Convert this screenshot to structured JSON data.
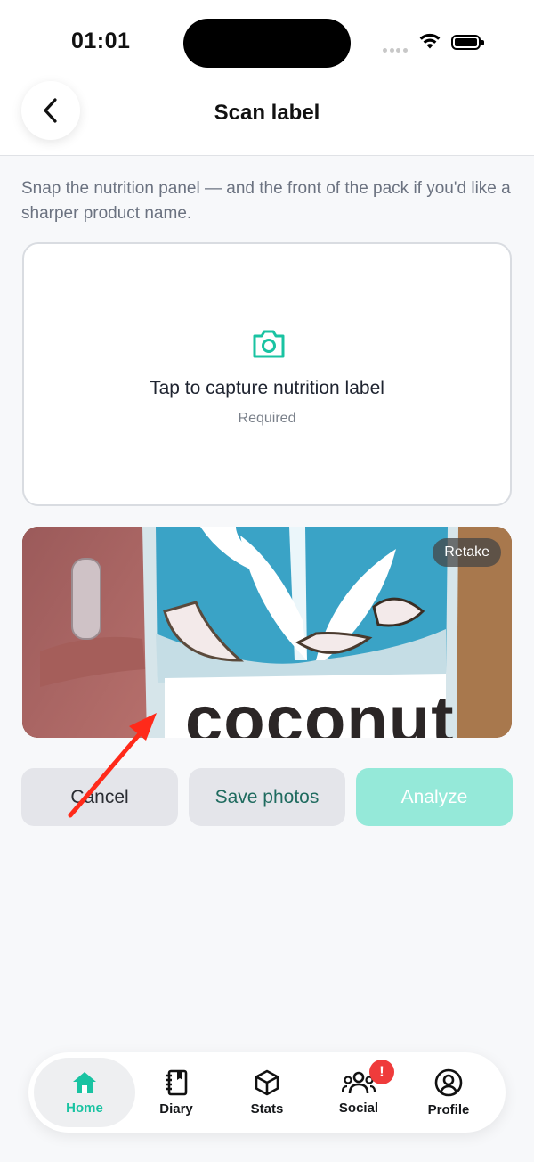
{
  "status_bar": {
    "time": "01:01"
  },
  "header": {
    "title": "Scan label"
  },
  "instructions": "Snap the nutrition panel — and the front of the pack if you'd like a sharper product name.",
  "capture_card": {
    "title": "Tap to capture nutrition label",
    "subtitle": "Required",
    "icon": "camera-icon"
  },
  "photo_card": {
    "retake_label": "Retake",
    "package_text": "coconut"
  },
  "actions": {
    "cancel_label": "Cancel",
    "save_label": "Save photos",
    "analyze_label": "Analyze"
  },
  "tab_bar": {
    "items": [
      {
        "label": "Home",
        "icon": "home-icon",
        "active": true
      },
      {
        "label": "Diary",
        "icon": "notebook-icon"
      },
      {
        "label": "Stats",
        "icon": "cube-icon"
      },
      {
        "label": "Social",
        "icon": "people-icon",
        "badge": "!"
      },
      {
        "label": "Profile",
        "icon": "user-circle-icon"
      }
    ]
  },
  "colors": {
    "accent": "#19c3a2",
    "analyze_bg": "#95e9d9",
    "badge": "#ef3b3b",
    "annotation_arrow": "#ff2a1a"
  }
}
